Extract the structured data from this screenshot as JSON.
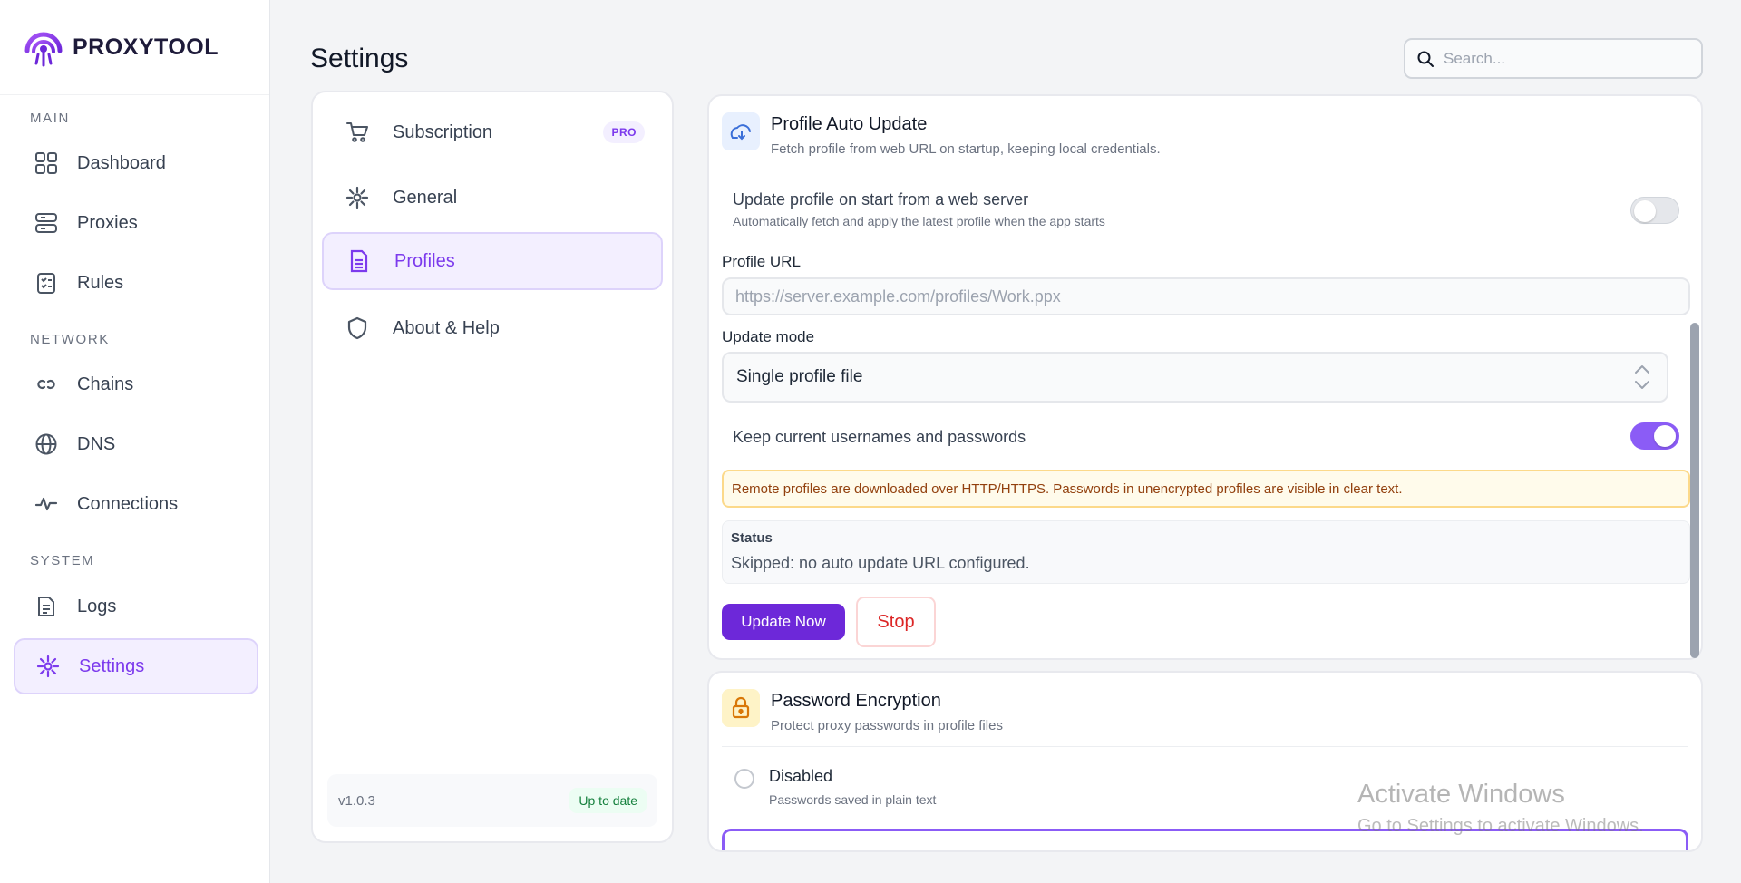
{
  "app": {
    "name": "PROXYTOOL"
  },
  "sidebar": {
    "sections": [
      {
        "label": "MAIN"
      },
      {
        "label": "NETWORK"
      },
      {
        "label": "SYSTEM"
      }
    ],
    "items": [
      {
        "label": "Dashboard",
        "icon": "grid-icon"
      },
      {
        "label": "Proxies",
        "icon": "server-icon"
      },
      {
        "label": "Rules",
        "icon": "clipboard-list-icon"
      },
      {
        "label": "Chains",
        "icon": "link-icon"
      },
      {
        "label": "DNS",
        "icon": "globe-icon"
      },
      {
        "label": "Connections",
        "icon": "activity-icon"
      },
      {
        "label": "Logs",
        "icon": "file-text-icon"
      },
      {
        "label": "Settings",
        "icon": "sun-gear-icon",
        "active": true
      }
    ]
  },
  "header": {
    "title": "Settings",
    "search_placeholder": "Search..."
  },
  "submenu": {
    "items": [
      {
        "label": "Subscription",
        "icon": "cart-icon",
        "badge": "PRO"
      },
      {
        "label": "General",
        "icon": "sun-gear-icon"
      },
      {
        "label": "Profiles",
        "icon": "file-icon",
        "active": true
      },
      {
        "label": "About & Help",
        "icon": "shield-icon"
      }
    ],
    "version": "v1.0.3",
    "update_status": "Up to date"
  },
  "auto_update": {
    "title": "Profile Auto Update",
    "subtitle": "Fetch profile from web URL on startup, keeping local credentials.",
    "start_toggle_title": "Update profile on start from a web server",
    "start_toggle_sub": "Automatically fetch and apply the latest profile when the app starts",
    "start_toggle_on": false,
    "url_label": "Profile URL",
    "url_placeholder": "https://server.example.com/profiles/Work.ppx",
    "mode_label": "Update mode",
    "mode_value": "Single profile file",
    "keep_creds_label": "Keep current usernames and passwords",
    "keep_creds_on": true,
    "warning": "Remote profiles are downloaded over HTTP/HTTPS. Passwords in unencrypted profiles are visible in clear text.",
    "status_label": "Status",
    "status_value": "Skipped: no auto update URL configured.",
    "update_button": "Update Now",
    "stop_button": "Stop"
  },
  "encryption": {
    "title": "Password Encryption",
    "subtitle": "Protect proxy passwords in profile files",
    "options": [
      {
        "title": "Disabled",
        "sub": "Passwords saved in plain text"
      }
    ]
  },
  "watermark": {
    "line1": "Activate Windows",
    "line2": "Go to Settings to activate Windows."
  },
  "colors": {
    "accent": "#7c3aed",
    "primary_button": "#6d28d9",
    "danger": "#dc2626",
    "success": "#15803d",
    "warning_bg": "#fffbeb"
  }
}
